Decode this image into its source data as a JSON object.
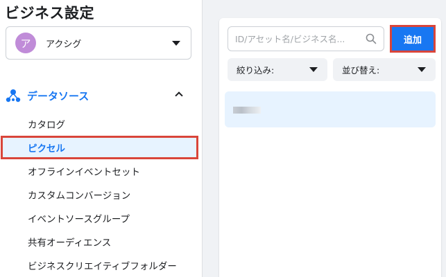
{
  "page": {
    "title": "ビジネス設定"
  },
  "account": {
    "avatar_letter": "ア",
    "name": "アクシグ"
  },
  "sidebar": {
    "section_label": "データソース",
    "items": [
      {
        "label": "カタログ"
      },
      {
        "label": "ピクセル",
        "active": true
      },
      {
        "label": "オフラインイベントセット"
      },
      {
        "label": "カスタムコンバージョン"
      },
      {
        "label": "イベントソースグループ"
      },
      {
        "label": "共有オーディエンス"
      },
      {
        "label": "ビジネスクリエイティブフォルダー"
      }
    ]
  },
  "panel": {
    "search_placeholder": "ID/アセット名/ビジネス名...",
    "add_label": "追加",
    "filter_label": "絞り込み:",
    "sort_label": "並び替え:"
  },
  "colors": {
    "accent": "#1877f2",
    "highlight_border": "#d9453a",
    "selected_bg": "#e7f3ff"
  },
  "icons": {
    "section": "data-source-icon",
    "search": "search-icon"
  }
}
